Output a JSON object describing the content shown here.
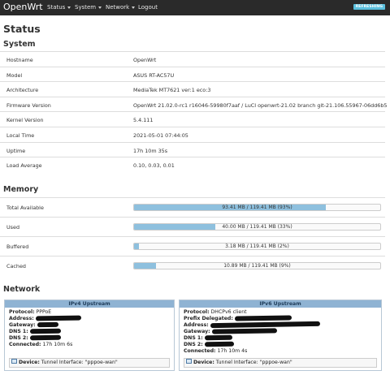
{
  "nav": {
    "brand": "OpenWrt",
    "items": [
      {
        "label": "Status",
        "has_caret": true
      },
      {
        "label": "System",
        "has_caret": true
      },
      {
        "label": "Network",
        "has_caret": true
      },
      {
        "label": "Logout",
        "has_caret": false
      }
    ],
    "refresh_badge": "REFRESHING"
  },
  "page_title": "Status",
  "system": {
    "title": "System",
    "rows": [
      {
        "label": "Hostname",
        "value": "OpenWrt"
      },
      {
        "label": "Model",
        "value": "ASUS RT-AC57U"
      },
      {
        "label": "Architecture",
        "value": "MediaTek MT7621 ver:1 eco:3"
      },
      {
        "label": "Firmware Version",
        "value": "OpenWrt 21.02.0-rc1 r16046-59980f7aaf / LuCI openwrt-21.02 branch git-21.106.55967-06dd6b5"
      },
      {
        "label": "Kernel Version",
        "value": "5.4.111"
      },
      {
        "label": "Local Time",
        "value": "2021-05-01 07:44:05"
      },
      {
        "label": "Uptime",
        "value": "17h 10m 35s"
      },
      {
        "label": "Load Average",
        "value": "0.10, 0.03, 0.01"
      }
    ]
  },
  "memory": {
    "title": "Memory",
    "rows": [
      {
        "label": "Total Available",
        "text": "93.41 MB / 119.41 MB (93%)",
        "fraction": 0.78
      },
      {
        "label": "Used",
        "text": "40.00 MB / 119.41 MB (33%)",
        "fraction": 0.33
      },
      {
        "label": "Buffered",
        "text": "3.18 MB / 119.41 MB (2%)",
        "fraction": 0.02
      },
      {
        "label": "Cached",
        "text": "10.89 MB / 119.41 MB (9%)",
        "fraction": 0.09
      }
    ]
  },
  "network": {
    "title": "Network",
    "ipv4": {
      "header": "IPv4 Upstream",
      "protocol_label": "Protocol:",
      "protocol_value": "PPPoE",
      "address_label": "Address:",
      "gateway_label": "Gateway:",
      "dns1_label": "DNS 1:",
      "dns2_label": "DNS 2:",
      "connected_label": "Connected:",
      "connected_value": "17h 10m 6s",
      "device_label": "Device:",
      "device_value": "Tunnel Interface: \"pppoe-wan\""
    },
    "ipv6": {
      "header": "IPv6 Upstream",
      "protocol_label": "Protocol:",
      "protocol_value": "DHCPv6 client",
      "prefix_label": "Prefix Delegated:",
      "address_label": "Address:",
      "gateway_label": "Gateway:",
      "dns1_label": "DNS 1:",
      "dns2_label": "DNS 2:",
      "connected_label": "Connected:",
      "connected_value": "17h 10m 4s",
      "device_label": "Device:",
      "device_value": "Tunnel Interface: \"pppoe-wan\""
    }
  },
  "colors": {
    "navbar": "#2a2a2a",
    "badge": "#5bc0de",
    "bar_fill": "#8ec0de",
    "panel_header": "#8fb3d3"
  }
}
